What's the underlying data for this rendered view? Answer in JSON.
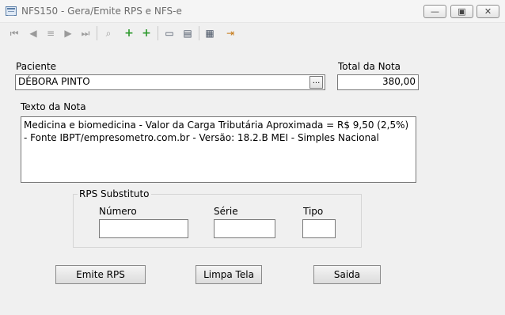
{
  "window": {
    "title": "NFS150 - Gera/Emite RPS e NFS-e",
    "minimize_glyph": "—",
    "maximize_glyph": "▣",
    "close_glyph": "✕"
  },
  "toolbar": {
    "icons": [
      "first-record-icon",
      "prev-record-icon",
      "stop-icon",
      "next-record-icon",
      "last-record-icon",
      "search-icon",
      "add-icon",
      "add-copy-icon",
      "save-icon",
      "print-icon",
      "report-icon",
      "exit-icon"
    ],
    "glyphs": {
      "first": "⏮",
      "prev": "◀",
      "stop": "≡",
      "next": "▶",
      "last": "⏭",
      "search": "⌕",
      "add": "+",
      "add_copy": "+",
      "save": "▭",
      "print": "▤",
      "report": "▦",
      "exit": "⇥"
    }
  },
  "form": {
    "patient_label": "Paciente",
    "patient_value": "DÉBORA PINTO",
    "lookup_button": "...",
    "total_label": "Total da Nota",
    "total_value": "380,00",
    "note_text_label": "Texto da Nota",
    "note_text_value": "Medicina e biomedicina - Valor da Carga Tributária Aproximada = R$ 9,50 (2,5%) - Fonte IBPT/empresometro.com.br - Versão: 18.2.B  MEI - Simples Nacional",
    "rps_group": {
      "legend": "RPS Substituto",
      "numero_label": "Número",
      "numero_value": "",
      "serie_label": "Série",
      "serie_value": "",
      "tipo_label": "Tipo",
      "tipo_value": ""
    }
  },
  "buttons": {
    "emit": "Emite RPS",
    "clear": "Limpa Tela",
    "exit": "Saida"
  }
}
